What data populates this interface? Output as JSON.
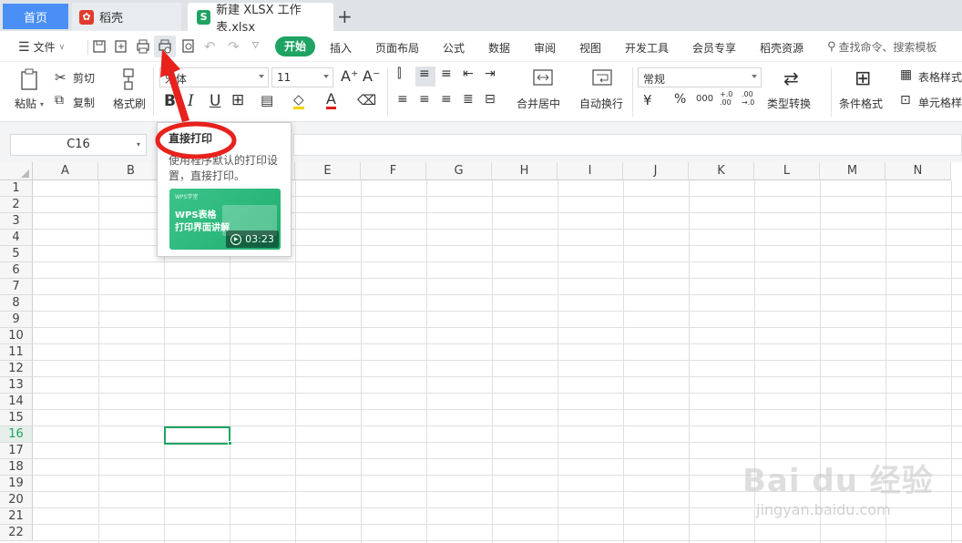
{
  "tabs": {
    "home": "首页",
    "daoke": "稻壳",
    "doc": "新建 XLSX 工作表.xlsx",
    "add": "+",
    "doc_logo": "S"
  },
  "menu": {
    "file": "文件",
    "items": [
      "开始",
      "插入",
      "页面布局",
      "公式",
      "数据",
      "审阅",
      "视图",
      "开发工具",
      "会员专享",
      "稻壳资源"
    ],
    "search": "查找命令、搜索模板"
  },
  "ribbon": {
    "paste": "粘贴",
    "cut": "剪切",
    "copy": "复制",
    "format_painter": "格式刷",
    "font_name": "宋体",
    "font_size": "11",
    "bold": "B",
    "italic": "I",
    "underline": "U",
    "font_color_letter": "A",
    "font_grow": "A⁺",
    "font_shrink": "A⁻",
    "merge": "合并居中",
    "wrap": "自动换行",
    "number_format": "常规",
    "currency": "¥",
    "percent": "%",
    "thousands": "000",
    "inc_decimal": "+.0\n.00",
    "dec_decimal": ".00\n→.0",
    "type_convert": "类型转换",
    "cond_format": "条件格式",
    "table_style": "表格样式",
    "cell_style": "单元格样"
  },
  "namebox": "C16",
  "columns": [
    "A",
    "B",
    "C",
    "D",
    "E",
    "F",
    "G",
    "H",
    "I",
    "J",
    "K",
    "L",
    "M",
    "N"
  ],
  "rows": [
    "1",
    "2",
    "3",
    "4",
    "5",
    "6",
    "7",
    "8",
    "9",
    "10",
    "11",
    "12",
    "13",
    "14",
    "15",
    "16",
    "17",
    "18",
    "19",
    "20",
    "21",
    "22"
  ],
  "active_row": "16",
  "tooltip": {
    "title": "直接打印",
    "desc_line1": "使用程序默认的打印设",
    "desc_line2": "置，直接打印。",
    "thumb_brand": "WPS学堂",
    "thumb_title1": "WPS表格",
    "thumb_title2": "打印界面讲解",
    "duration": "03:23"
  },
  "watermark": {
    "text": "Bai du 经验",
    "url": "jingyan.baidu.com"
  },
  "colors": {
    "accent": "#1ea362",
    "active_tab": "#4a8ff5",
    "annotation": "#e8211c"
  }
}
